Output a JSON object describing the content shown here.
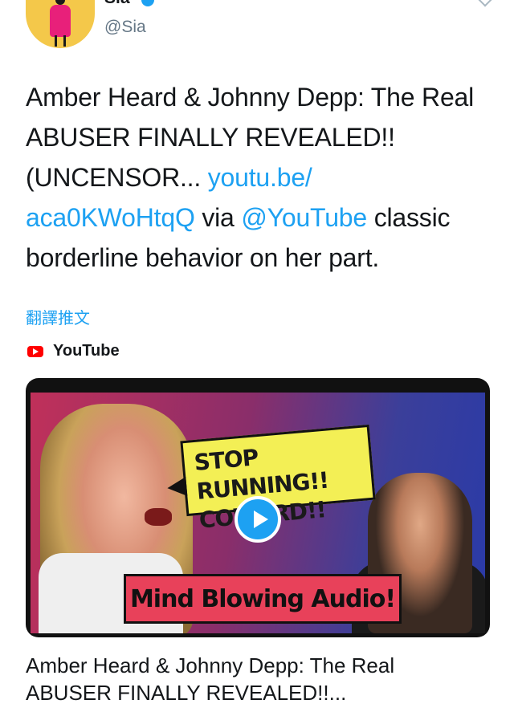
{
  "user": {
    "display_name": "Sia",
    "handle": "@Sia"
  },
  "tweet": {
    "text_part1": "Amber Heard & Johnny Depp:  The Real ABUSER FINALLY REVEALED!! (UNCENSOR... ",
    "link1": "youtu.be/\naca0KWoHtqQ",
    "text_part2": " via ",
    "mention": "@YouTube",
    "text_part3": " classic borderline behavior on her part."
  },
  "translate_label": "翻譯推文",
  "card": {
    "source": "YouTube",
    "bubble_line1": "STOP RUNNING!!",
    "bubble_line2": "COWARD!!",
    "banner": "Mind Blowing Audio!",
    "title_line1": "Amber Heard & Johnny Depp: The Real",
    "title_line2": "ABUSER FINALLY REVEALED!!..."
  },
  "colors": {
    "link": "#1da1f2",
    "text": "#14171a",
    "secondary": "#657786"
  },
  "icons": [
    "verified-badge-icon",
    "caret-down-icon",
    "youtube-logo-icon",
    "play-icon"
  ]
}
